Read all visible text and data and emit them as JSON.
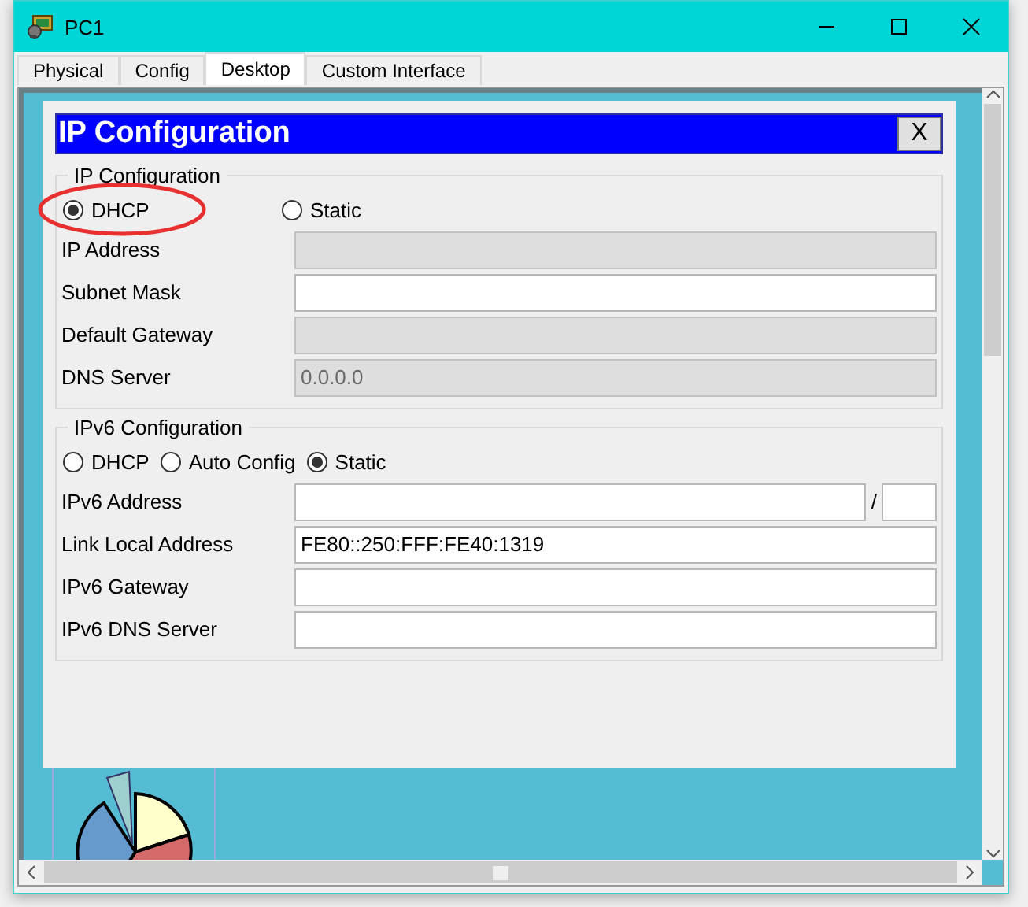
{
  "window": {
    "title": "PC1"
  },
  "tabs": [
    {
      "label": "Physical",
      "selected": false
    },
    {
      "label": "Config",
      "selected": false
    },
    {
      "label": "Desktop",
      "selected": true
    },
    {
      "label": "Custom Interface",
      "selected": false
    }
  ],
  "dialog": {
    "title": "IP Configuration",
    "close": "X",
    "sections": [
      {
        "legend": "IP Configuration",
        "modes": [
          {
            "label": "DHCP",
            "selected": true,
            "highlighted": true
          },
          {
            "label": "Static",
            "selected": false,
            "highlighted": false
          }
        ],
        "fields": [
          {
            "label": "IP Address",
            "disabled": true
          },
          {
            "label": "Subnet Mask",
            "disabled": false
          },
          {
            "label": "Default Gateway",
            "disabled": true
          },
          {
            "label": "DNS Server",
            "value": "0.0.0.0",
            "disabled": true
          }
        ]
      },
      {
        "legend": "IPv6 Configuration",
        "modes": [
          {
            "label": "DHCP",
            "selected": false,
            "highlighted": false
          },
          {
            "label": "Auto Config",
            "selected": false,
            "highlighted": false
          },
          {
            "label": "Static",
            "selected": true,
            "highlighted": false
          }
        ],
        "fields": [
          {
            "label": "IPv6 Address",
            "disabled": false,
            "prefix_separator": "/"
          },
          {
            "label": "Link Local Address",
            "value": "FE80::250:FFF:FE40:1319",
            "disabled": false
          },
          {
            "label": "IPv6 Gateway",
            "disabled": false
          },
          {
            "label": "IPv6 DNS Server",
            "disabled": false
          }
        ]
      }
    ]
  }
}
